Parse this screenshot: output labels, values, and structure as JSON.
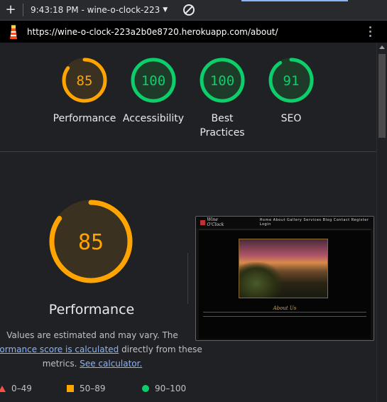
{
  "toolbar": {
    "add_label": "+",
    "run_label": "9:43:18 PM - wine-o-clock-223"
  },
  "url": {
    "address": "https://wine-o-clock-223a2b0e8720.herokuapp.com/about/"
  },
  "summary": {
    "gauges": [
      {
        "score": "85",
        "value": 85,
        "label": "Performance",
        "label2": "",
        "color": "#ffa400"
      },
      {
        "score": "100",
        "value": 100,
        "label": "Accessibility",
        "label2": "",
        "color": "#0cce6b"
      },
      {
        "score": "100",
        "value": 100,
        "label": "Best",
        "label2": "Practices",
        "color": "#0cce6b"
      },
      {
        "score": "91",
        "value": 91,
        "label": "SEO",
        "label2": "",
        "color": "#0cce6b"
      }
    ]
  },
  "performance": {
    "score": "85",
    "value": 85,
    "title": "Performance",
    "note_line1": "Values are estimated and may vary. The",
    "note_link": "performance score is calculated",
    "note_line2_rest": " directly from these",
    "note_line3_start": "metrics. ",
    "note_link2": "See calculator."
  },
  "legend": [
    {
      "range": "0–49",
      "shape": "triangle",
      "color": "#ff4e42"
    },
    {
      "range": "50–89",
      "shape": "square",
      "color": "#ffa400"
    },
    {
      "range": "90–100",
      "shape": "circle",
      "color": "#0cce6b"
    }
  ],
  "thumbnail": {
    "brand": "Wine O'Clock",
    "nav_links": "Home  About  Gallery  Services  Blog  Contact  Register  Login",
    "heading": "About Us"
  }
}
